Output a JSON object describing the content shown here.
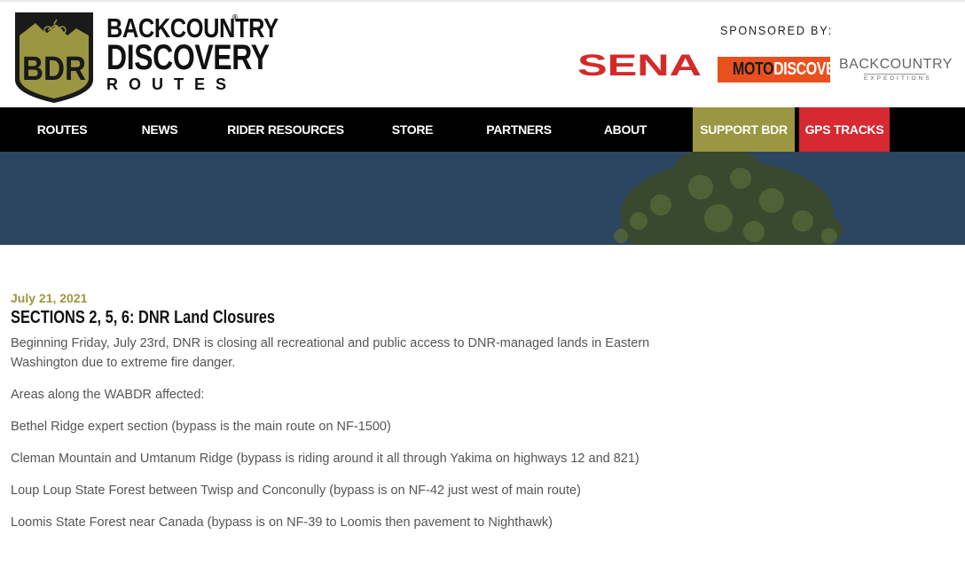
{
  "logo": {
    "badge_text": "BDR",
    "line1": "BACKCOUNTRY",
    "line2": "DISCOVERY",
    "line3": "ROUTES",
    "registered": "®"
  },
  "sponsors": {
    "label": "SPONSORED BY:",
    "sena": "SENA",
    "moto_part1": "MOTO",
    "moto_part2": "DISCOVERY",
    "backcountry_line1": "BACKCOUNTRY",
    "backcountry_line2": "EXPEDITIONS"
  },
  "nav": {
    "items": [
      {
        "label": "ROUTES"
      },
      {
        "label": "NEWS"
      },
      {
        "label": "RIDER RESOURCES"
      },
      {
        "label": "STORE"
      },
      {
        "label": "PARTNERS"
      },
      {
        "label": "ABOUT"
      },
      {
        "label": "SUPPORT BDR"
      },
      {
        "label": "GPS TRACKS"
      }
    ]
  },
  "article": {
    "date": "July 21, 2021",
    "title": "SECTIONS 2, 5, 6: DNR Land Closures",
    "paragraphs": [
      "Beginning Friday, July 23rd, DNR is closing all recreational and public access to DNR-managed lands in Eastern Washington due to extreme fire danger.",
      "Areas along the WABDR affected:",
      "Bethel Ridge expert section (bypass is the main route on NF-1500)",
      "Cleman Mountain and Umtanum Ridge (bypass is riding around it all through Yakima on highways 12 and 821)",
      "Loup Loup State Forest between Twisp and Conconully (bypass is on NF-42 just west of main route)",
      "Loomis State Forest near Canada (bypass is on NF-39 to Loomis then pavement to Nighthawk)"
    ]
  },
  "colors": {
    "nav_bg": "#000000",
    "support_bg": "#9b9641",
    "gps_bg": "#d62932",
    "hero_bg": "#2c4661",
    "date_color": "#9b9641",
    "sena_red": "#d42a2a",
    "moto_orange": "#e8511e"
  }
}
